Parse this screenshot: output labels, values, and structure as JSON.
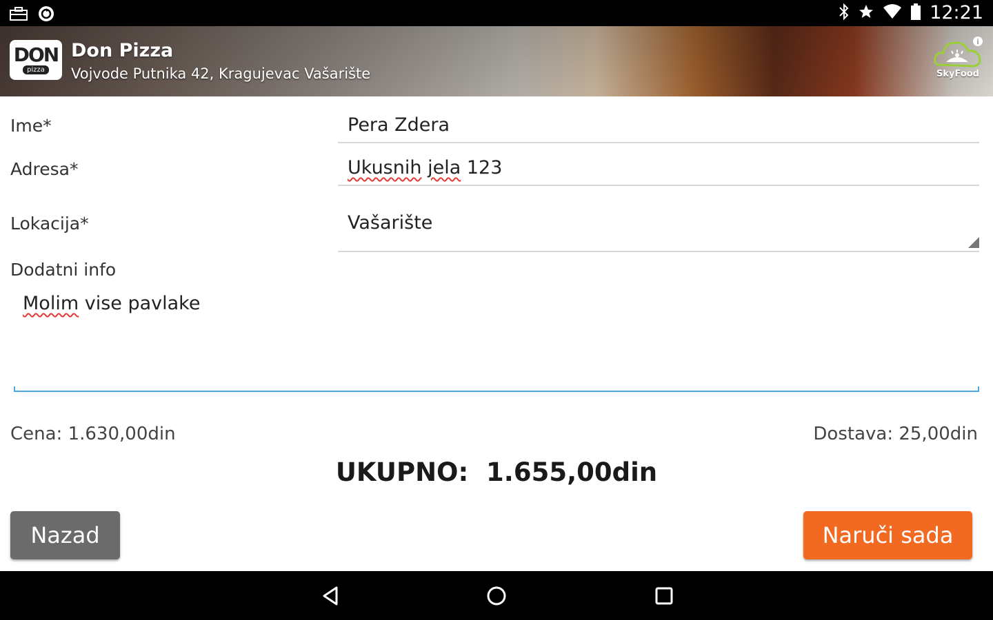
{
  "status_bar": {
    "time": "12:21",
    "left_icons": [
      "briefcase-icon",
      "sync-icon"
    ],
    "right_icons": [
      "bluetooth-icon",
      "star-icon",
      "wifi-icon",
      "battery-icon"
    ]
  },
  "header": {
    "logo_main": "DON",
    "logo_sub": "pizza",
    "shop_name": "Don Pizza",
    "shop_address": "Vojvode Putnika 42, Kragujevac Vašarište",
    "brand_badge": "SkyFood"
  },
  "form": {
    "name_label": "Ime*",
    "name_value": "Pera Zdera",
    "address_label": "Adresa*",
    "address_value_word1": "Ukusnih",
    "address_value_word2": "jela",
    "address_value_rest": "123",
    "location_label": "Lokacija*",
    "location_value": "Vašarište",
    "info_label": "Dodatni info",
    "info_value_word1": "Molim",
    "info_value_rest": "vise pavlake"
  },
  "summary": {
    "price": "Cena: 1.630,00din",
    "delivery": "Dostava: 25,00din",
    "total": "UKUPNO:  1.655,00din"
  },
  "buttons": {
    "back_label": "Nazad",
    "order_label": "Naruči sada"
  },
  "nav": [
    "back-icon",
    "home-icon",
    "recents-icon"
  ],
  "colors": {
    "accent_orange": "#f26a22",
    "back_button_gray": "#6b6b6b",
    "focus_blue": "#4aa8e0"
  }
}
